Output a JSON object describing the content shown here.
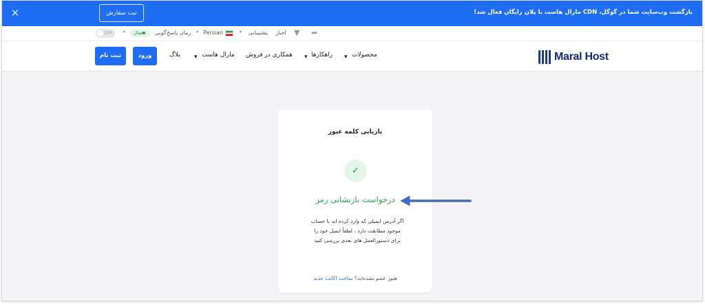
{
  "promo": {
    "text": "بازگشت وب‌سایت شما در گوگل، CDN مارال هاست با پلان رایگان فعال شد!",
    "order_button": "ثبت سفارش",
    "close_icon": "close-icon"
  },
  "utility": {
    "toggle_label": "OFF",
    "active_badge": "فعال",
    "response_time": "زمان پاسخ‌گویی",
    "language": "Persian",
    "support": "پشتیبانی",
    "news": "اخبار"
  },
  "nav": {
    "register": "ثبت نام",
    "login": "ورود",
    "blog": "بلاگ",
    "maral_host": "مارال هاست",
    "sales_partnership": "همکاری در فروش",
    "solutions": "راهکارها",
    "products": "محصولات",
    "logo_text": "Maral Host"
  },
  "card": {
    "title": "بازیابی کلمه عبور",
    "heading": "درخواست بازنشانی رمز",
    "message_lines": [
      "اگر آدرس ایمیلی که وارد کرده اید با حساب",
      "موجود مطابقت دارد ، لطفاً ایمیل خود را",
      "برای دستورالعمل های بعدی بررسی کنید"
    ],
    "footer_prefix": "هنوز عضو نشده‌اید؟",
    "footer_link": "ساخت اکانت جدید"
  },
  "colors": {
    "brand_blue": "#1e6df2",
    "success_green": "#27a44b",
    "logo_navy": "#13297a"
  }
}
